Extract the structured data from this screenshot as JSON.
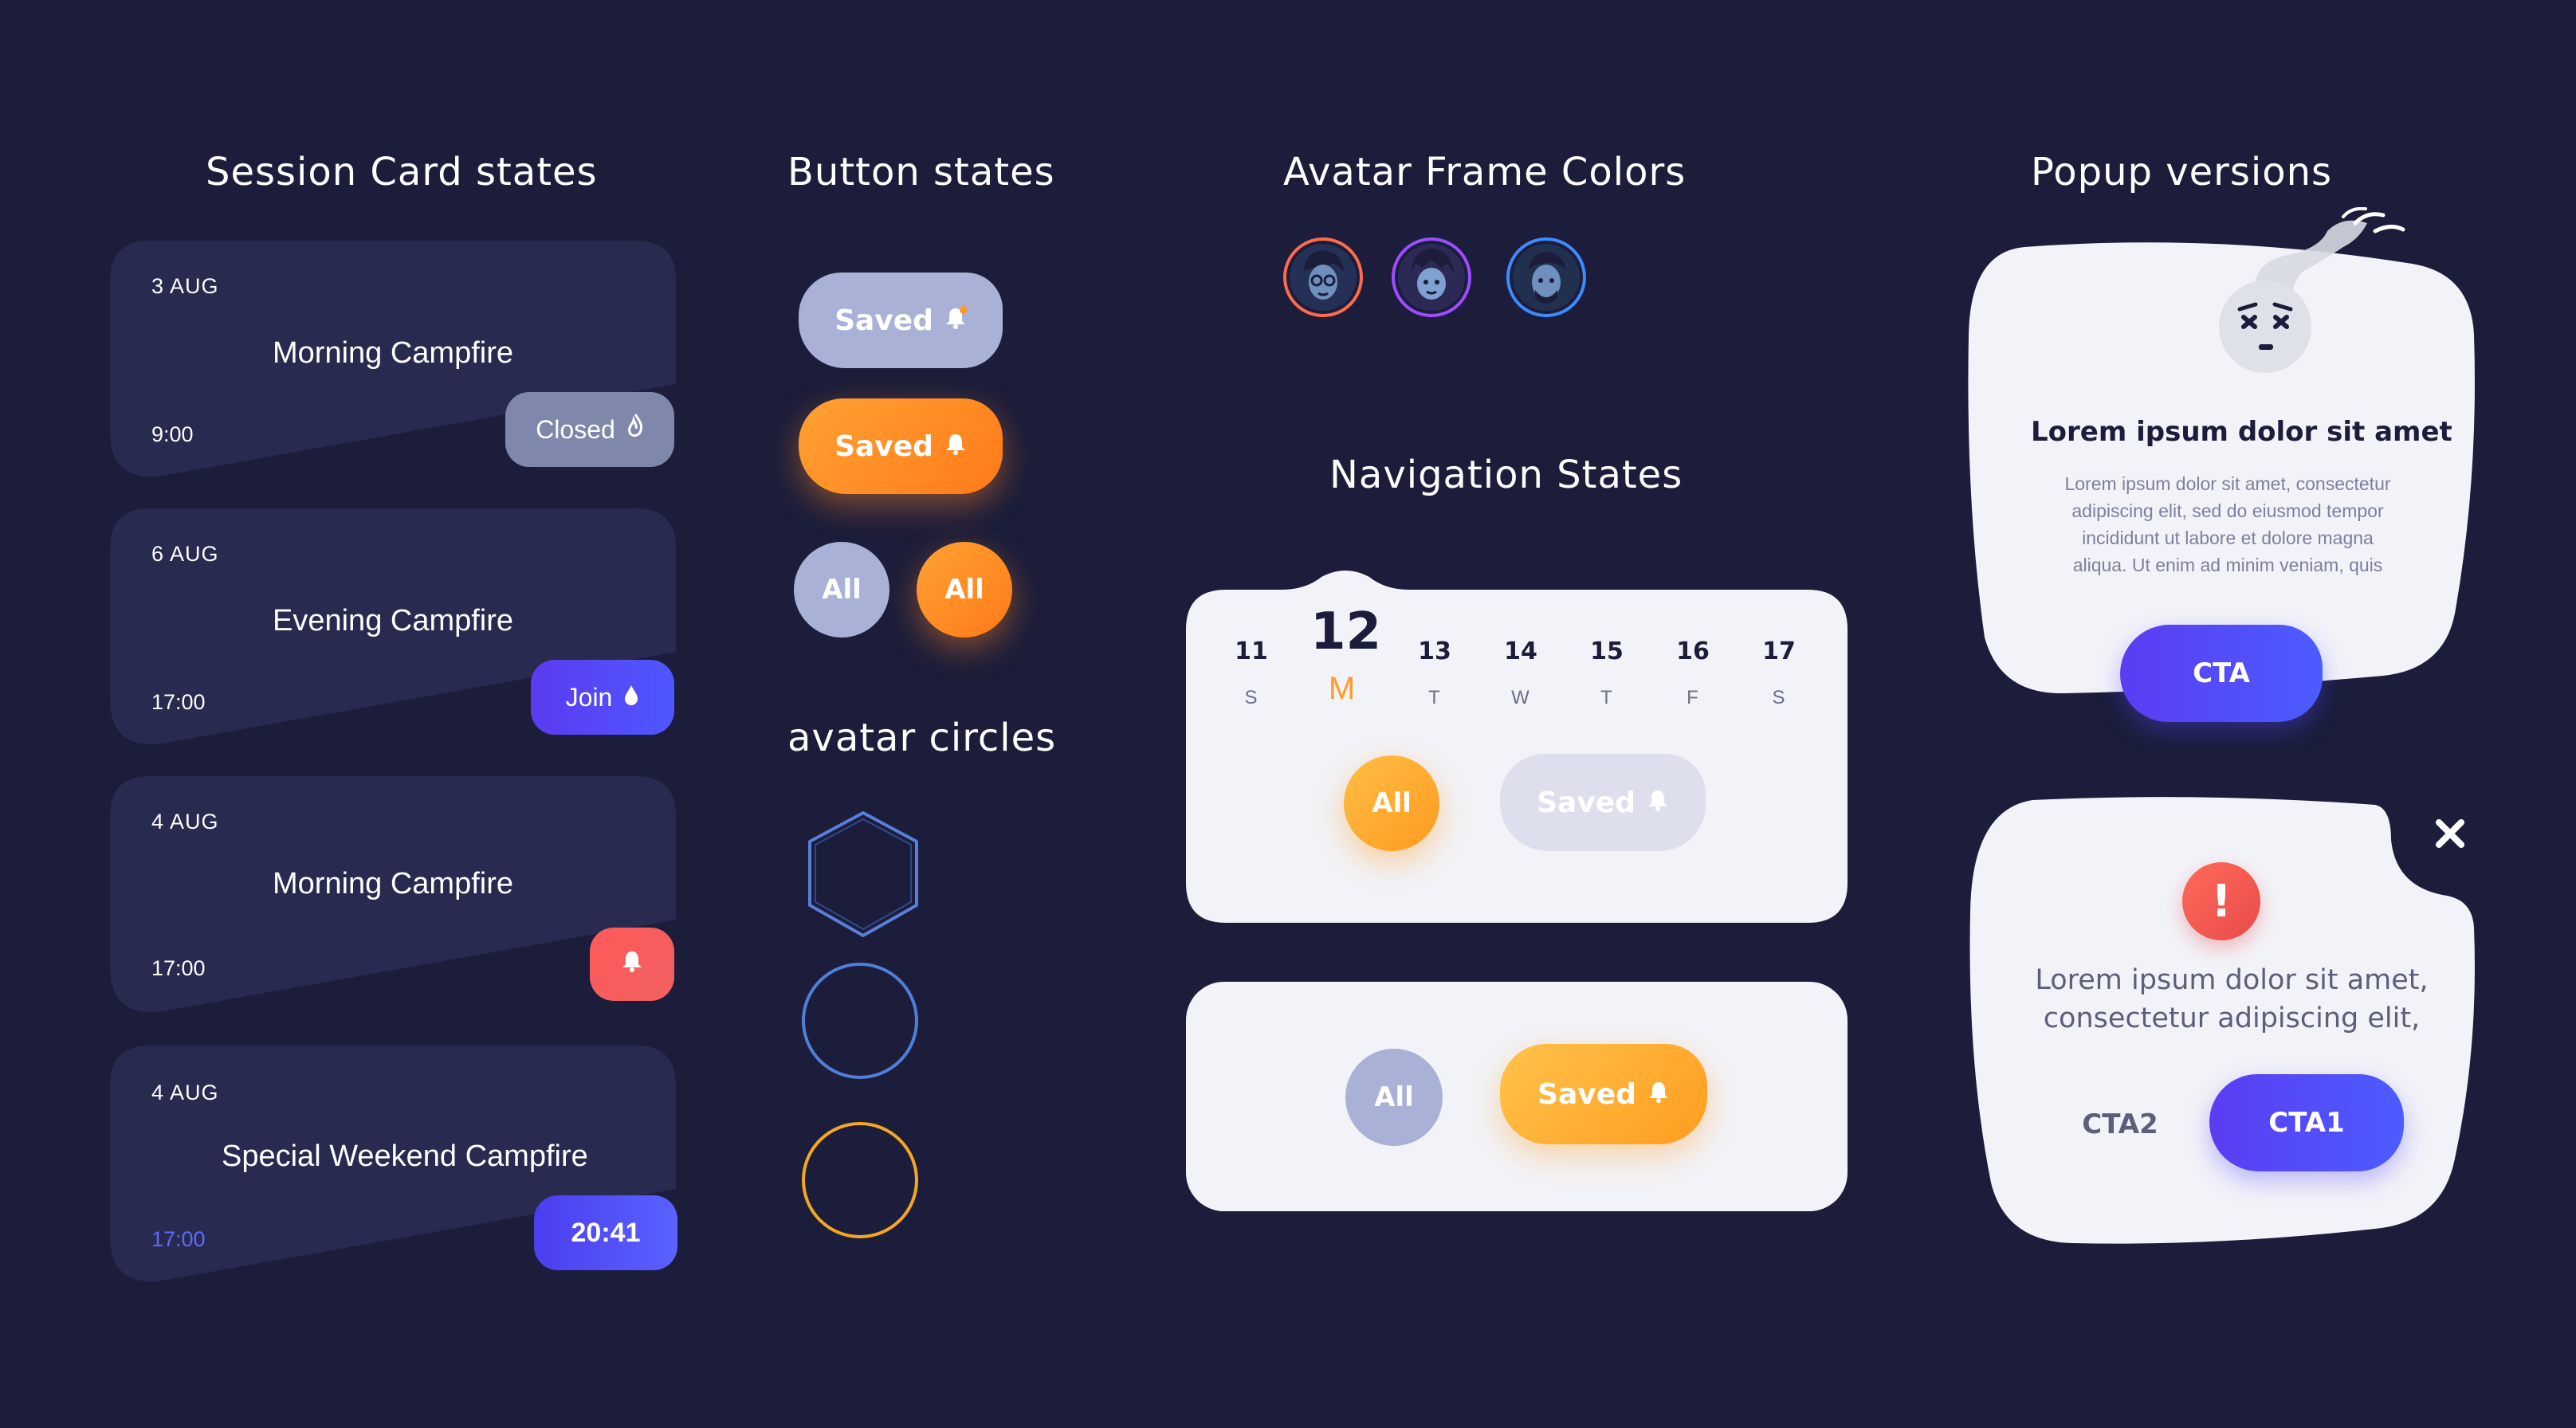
{
  "titles": {
    "session_cards": "Session Card states",
    "buttons": "Button states",
    "avatar_frames": "Avatar Frame Colors",
    "navigation": "Navigation States",
    "avatar_circles": "avatar circles",
    "popups": "Popup versions"
  },
  "session_cards": [
    {
      "date": "3 AUG",
      "title": "Morning Campfire",
      "time": "9:00",
      "status": "Closed",
      "status_icon": "flame-icon"
    },
    {
      "date": "6 AUG",
      "title": "Evening Campfire",
      "time": "17:00",
      "status": "Join",
      "status_icon": "drop-icon"
    },
    {
      "date": "4 AUG",
      "title": "Morning Campfire",
      "time": "17:00",
      "status": "",
      "status_icon": "bell-icon"
    },
    {
      "date": "4 AUG",
      "title": "Special Weekend Campfire",
      "time": "17:00",
      "status": "20:41",
      "status_icon": ""
    }
  ],
  "buttons": {
    "saved_gray": "Saved",
    "saved_orange": "Saved",
    "all_gray": "All",
    "all_orange": "All"
  },
  "avatar_frame_colors": [
    "#ff6b4a",
    "#9b4dff",
    "#3d8bff"
  ],
  "avatar_circles": [
    "hexagon",
    "circle-blue",
    "circle-orange"
  ],
  "navigation": {
    "days": [
      {
        "num": "11",
        "letter": "S"
      },
      {
        "num": "12",
        "letter": "M",
        "selected": true
      },
      {
        "num": "13",
        "letter": "T"
      },
      {
        "num": "14",
        "letter": "W"
      },
      {
        "num": "15",
        "letter": "T"
      },
      {
        "num": "16",
        "letter": "F"
      },
      {
        "num": "17",
        "letter": "S"
      }
    ],
    "panel1": {
      "all": "All",
      "saved": "Saved"
    },
    "panel2": {
      "all": "All",
      "saved": "Saved"
    }
  },
  "popup1": {
    "title": "Lorem ipsum dolor sit amet",
    "body_lines": [
      "Lorem ipsum dolor sit amet, consectetur",
      "adipiscing elit, sed do eiusmod tempor",
      "incididunt ut labore et dolore magna",
      "aliqua. Ut enim ad minim veniam, quis"
    ],
    "cta": "CTA"
  },
  "popup2": {
    "body_lines": [
      "Lorem ipsum dolor sit amet,",
      "consectetur adipiscing elit,"
    ],
    "cta2": "CTA2",
    "cta1": "CTA1",
    "alert_symbol": "!"
  },
  "colors": {
    "background": "#1b1d3a",
    "card": "#282a4f",
    "accent_blue": "#4f57ff",
    "accent_orange": "#ff8a1e",
    "danger": "#f05a5a"
  }
}
